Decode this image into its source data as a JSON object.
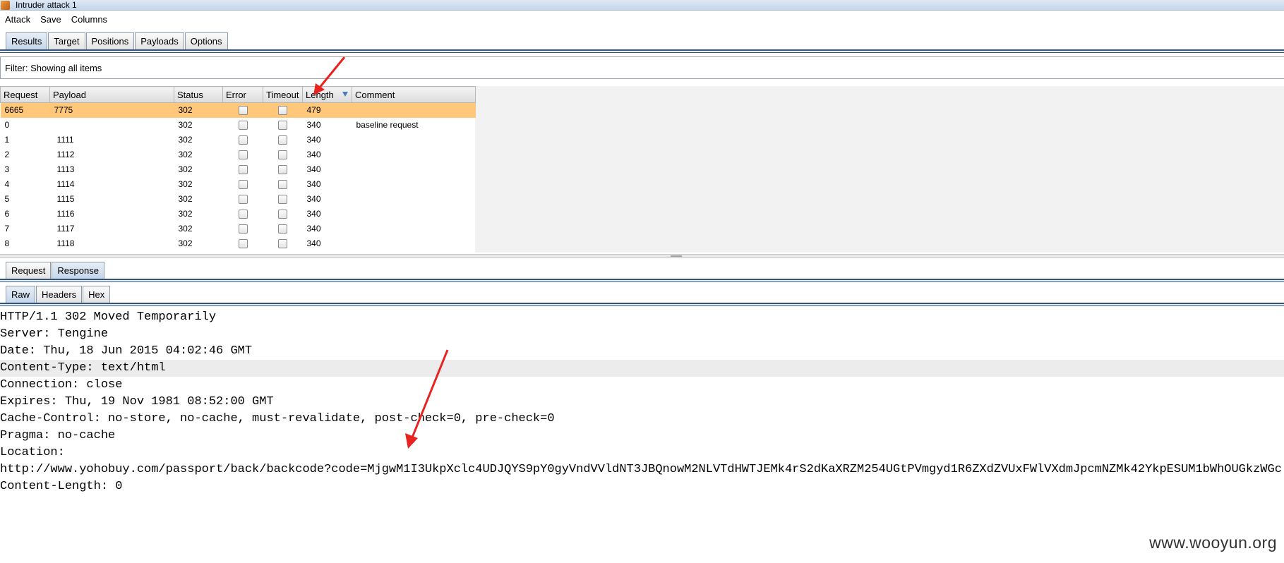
{
  "window": {
    "title": "Intruder attack 1"
  },
  "menu": [
    "Attack",
    "Save",
    "Columns"
  ],
  "main_tabs": [
    {
      "label": "Results",
      "active": true
    },
    {
      "label": "Target",
      "active": false
    },
    {
      "label": "Positions",
      "active": false
    },
    {
      "label": "Payloads",
      "active": false
    },
    {
      "label": "Options",
      "active": false
    }
  ],
  "filter": {
    "text": "Filter: Showing all items"
  },
  "table": {
    "columns": [
      "Request",
      "Payload",
      "Status",
      "Error",
      "Timeout",
      "Length",
      "Comment"
    ],
    "sorted_column": "Length",
    "selected_row_color": "#ffc77a",
    "rows": [
      {
        "request": "6665",
        "payload": "7775",
        "status": "302",
        "error": false,
        "timeout": false,
        "length": "479",
        "comment": "",
        "selected": true
      },
      {
        "request": "0",
        "payload": "",
        "status": "302",
        "error": false,
        "timeout": false,
        "length": "340",
        "comment": "baseline request",
        "selected": false
      },
      {
        "request": "1",
        "payload": "1111",
        "status": "302",
        "error": false,
        "timeout": false,
        "length": "340",
        "comment": "",
        "selected": false
      },
      {
        "request": "2",
        "payload": "1112",
        "status": "302",
        "error": false,
        "timeout": false,
        "length": "340",
        "comment": "",
        "selected": false
      },
      {
        "request": "3",
        "payload": "1113",
        "status": "302",
        "error": false,
        "timeout": false,
        "length": "340",
        "comment": "",
        "selected": false
      },
      {
        "request": "4",
        "payload": "1114",
        "status": "302",
        "error": false,
        "timeout": false,
        "length": "340",
        "comment": "",
        "selected": false
      },
      {
        "request": "5",
        "payload": "1115",
        "status": "302",
        "error": false,
        "timeout": false,
        "length": "340",
        "comment": "",
        "selected": false
      },
      {
        "request": "6",
        "payload": "1116",
        "status": "302",
        "error": false,
        "timeout": false,
        "length": "340",
        "comment": "",
        "selected": false
      },
      {
        "request": "7",
        "payload": "1117",
        "status": "302",
        "error": false,
        "timeout": false,
        "length": "340",
        "comment": "",
        "selected": false
      },
      {
        "request": "8",
        "payload": "1118",
        "status": "302",
        "error": false,
        "timeout": false,
        "length": "340",
        "comment": "",
        "selected": false
      }
    ]
  },
  "detail_tabs": [
    {
      "label": "Request",
      "active": false
    },
    {
      "label": "Response",
      "active": true
    }
  ],
  "view_tabs": [
    {
      "label": "Raw",
      "active": true
    },
    {
      "label": "Headers",
      "active": false
    },
    {
      "label": "Hex",
      "active": false
    }
  ],
  "response": {
    "lines": [
      {
        "text": "HTTP/1.1 302 Moved Temporarily",
        "highlight": false
      },
      {
        "text": "Server: Tengine",
        "highlight": false
      },
      {
        "text": "Date: Thu, 18 Jun 2015 04:02:46 GMT",
        "highlight": false
      },
      {
        "text": "Content-Type: text/html",
        "highlight": true
      },
      {
        "text": "Connection: close",
        "highlight": false
      },
      {
        "text": "Expires: Thu, 19 Nov 1981 08:52:00 GMT",
        "highlight": false
      },
      {
        "text": "Cache-Control: no-store, no-cache, must-revalidate, post-check=0, pre-check=0",
        "highlight": false
      },
      {
        "text": "Pragma: no-cache",
        "highlight": false
      },
      {
        "text": "Location:",
        "highlight": false
      },
      {
        "text": "http://www.yohobuy.com/passport/back/backcode?code=MjgwM1I3UkpXclc4UDJQYS9pY0gyVndVVldNT3JBQnowM2NLVTdHWTJEMk4rS2dKaXRZM254UGtPVmgyd1R6ZXdZVUxFWlVXdmJpcmNZMk42YkpESUM1bWhOUGkzWGc.",
        "highlight": false
      },
      {
        "text": "Content-Length: 0",
        "highlight": false
      }
    ]
  },
  "annotation_color": "#e8231f",
  "watermark": "www.wooyun.org"
}
